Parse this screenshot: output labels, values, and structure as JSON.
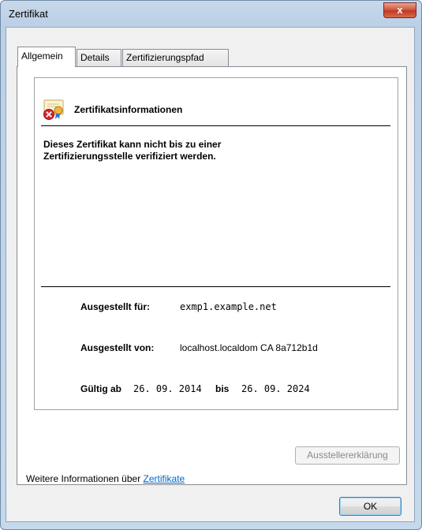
{
  "window": {
    "title": "Zertifikat",
    "close_symbol": "x"
  },
  "tabs": [
    {
      "label": "Allgemein",
      "active": true
    },
    {
      "label": "Details",
      "active": false
    },
    {
      "label": "Zertifizierungspfad",
      "active": false
    }
  ],
  "info": {
    "heading": "Zertifikatsinformationen",
    "warning_line1": "Dieses Zertifikat kann nicht bis zu einer",
    "warning_line2": "Zertifizierungsstelle verifiziert werden.",
    "issued_to_label": "Ausgestellt für:",
    "issued_to_value": "exmp1.example.net",
    "issued_by_label": "Ausgestellt von:",
    "issued_by_value": "localhost.localdom CA 8a712b1d",
    "valid_from_label": "Gültig ab",
    "valid_from_value": "26. 09. 2014",
    "valid_to_label": "bis",
    "valid_to_value": "26. 09. 2024"
  },
  "issuer_statement_button": "Ausstellererklärung",
  "more_info": {
    "text": "Weitere Informationen über ",
    "link": "Zertifikate"
  },
  "ok_button": "OK",
  "icons": {
    "certificate": "certificate-error-icon"
  }
}
